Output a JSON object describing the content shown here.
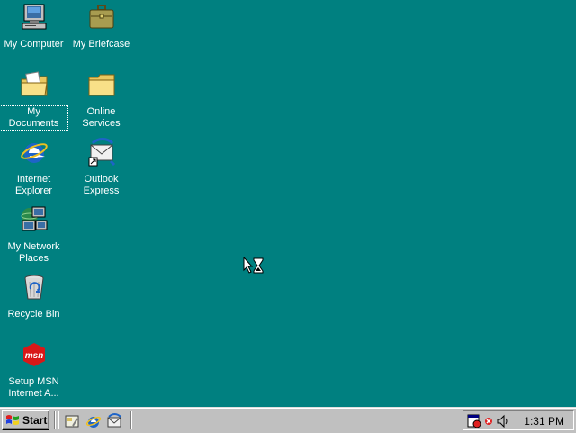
{
  "desktop": {
    "icons": {
      "my_computer": "My Computer",
      "my_briefcase": "My Briefcase",
      "my_documents": "My Documents",
      "online_services": "Online\nServices",
      "internet_explorer": "Internet\nExplorer",
      "outlook_express": "Outlook\nExpress",
      "my_network_places": "My Network\nPlaces",
      "recycle_bin": "Recycle Bin",
      "setup_msn": "Setup MSN\nInternet A...",
      "msn_logo_text": "msn"
    },
    "background_color": "#008080"
  },
  "taskbar": {
    "start_label": "Start",
    "quick_launch": [
      "show-desktop-icon",
      "internet-explorer-icon",
      "outlook-express-icon"
    ],
    "tray_icons": [
      "scheduler-icon",
      "network-status-icon",
      "volume-icon"
    ],
    "clock": "1:31 PM"
  },
  "cursor": "busy-arrow-hourglass"
}
